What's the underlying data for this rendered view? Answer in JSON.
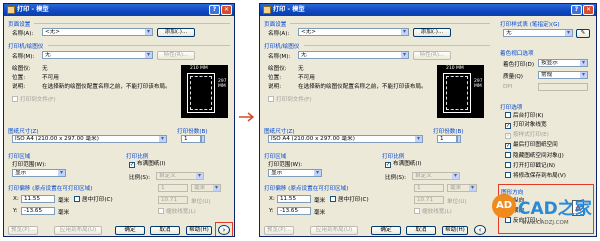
{
  "dialog": {
    "title": "打印 - 模型",
    "page_setup": {
      "group": "页面设置",
      "name_label": "名称(A):",
      "name_value": "<无>",
      "add_button": "添加(.)..."
    },
    "printer": {
      "group": "打印机/绘图仪",
      "name_label": "名称(M):",
      "name_value": "无",
      "properties_button": "特性(R)...",
      "plotter_label": "绘图仪:",
      "plotter_value": "无",
      "location_label": "位置:",
      "location_value": "不可用",
      "desc_label": "说明:",
      "desc_value": "在选择新的绘图仪配置名称之前，不能打印该布局。",
      "print_to_file": "打印到文件(F)",
      "preview_width": "210 MM",
      "preview_height": "297 MM"
    },
    "paper": {
      "group": "图纸尺寸(Z)",
      "value": "ISO A4 (210.00 x 297.00 毫米)"
    },
    "copies": {
      "group": "打印份数(B)",
      "value": "1"
    },
    "plot_area": {
      "group": "打印区域",
      "what_label": "打印范围(W):",
      "what_value": "显示"
    },
    "scale": {
      "group": "打印比例",
      "fit_label": "布满图纸(I)",
      "scale_label": "比例(S):",
      "scale_value": "自定义",
      "num": "1",
      "unit": "毫米",
      "den": "10.71",
      "unit2": "单位(U)",
      "lineweights": "缩放线宽(L)"
    },
    "offset": {
      "group": "打印偏移 (原点设置在可打印区域)",
      "x_label": "X:",
      "x_value": "11.55",
      "x_unit": "毫米",
      "y_label": "Y:",
      "y_value": "-13.65",
      "y_unit": "毫米",
      "center_label": "居中打印(C)"
    },
    "buttons": {
      "preview": "预览(P)...",
      "apply": "应用到布局(U)",
      "ok": "确定",
      "cancel": "取消",
      "help": "帮助(H)"
    },
    "more_options_icon": "chevron-right-icon",
    "style_table": {
      "group": "打印样式表 (笔指定)(G)",
      "value": "无"
    },
    "shaded": {
      "group": "着色视口选项",
      "shade_label": "着色打印(D)",
      "shade_value": "按显示",
      "quality_label": "质量(Q)",
      "quality_value": "常规",
      "dpi_label": "DPI"
    },
    "options": {
      "group": "打印选项",
      "items": [
        "后台打印(K)",
        "打印对象线宽",
        "按样式打印(E)",
        "最后打印图纸空间",
        "隐藏图纸空间对象(J)",
        "打开打印戳记(N)",
        "将修改保存到布局(V)"
      ],
      "checked": [
        false,
        true,
        true,
        true,
        false,
        false,
        false
      ],
      "disabled": [
        false,
        false,
        true,
        false,
        false,
        false,
        false
      ]
    },
    "orientation": {
      "group": "图形方向",
      "portrait": "纵向",
      "landscape": "横向",
      "upside_down": "反向打印(-)"
    },
    "watermark": {
      "logo": "AD",
      "text": "CAD之家",
      "url": "www.CADZJ.COM"
    },
    "colors": {
      "title_bar": "#0d46c0",
      "group_label": "#0046d5",
      "highlight": "#e23b2a",
      "dialog_bg": "#ece9d8"
    }
  }
}
